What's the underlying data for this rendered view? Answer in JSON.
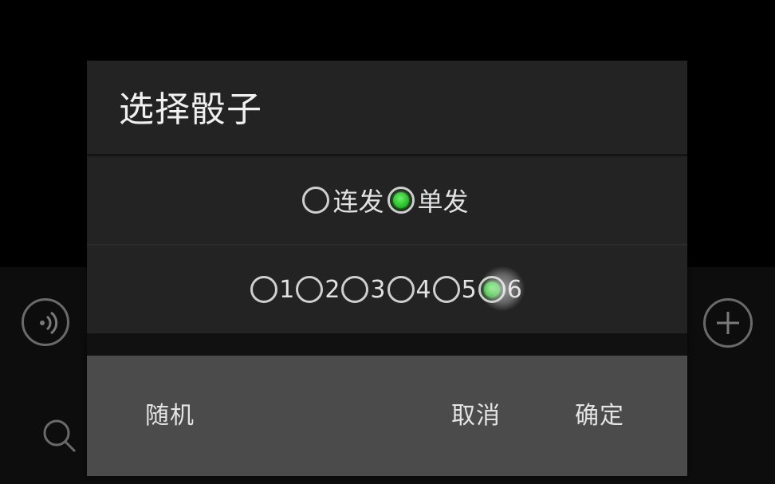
{
  "dialog": {
    "title": "选择骰子",
    "mode_options": [
      {
        "label": "连发",
        "checked": false
      },
      {
        "label": "单发",
        "checked": true
      }
    ],
    "dice_options": [
      {
        "label": "1",
        "checked": false
      },
      {
        "label": "2",
        "checked": false
      },
      {
        "label": "3",
        "checked": false
      },
      {
        "label": "4",
        "checked": false
      },
      {
        "label": "5",
        "checked": false
      },
      {
        "label": "6",
        "checked": true
      }
    ],
    "buttons": {
      "random": "随机",
      "cancel": "取消",
      "ok": "确定"
    }
  },
  "background": {
    "icons": [
      "voice-icon",
      "plus-icon",
      "search-icon"
    ]
  },
  "colors": {
    "radio_checked": "#2fc42f",
    "dialog_bg": "#232323",
    "button_bar_bg": "#4b4b4b"
  }
}
